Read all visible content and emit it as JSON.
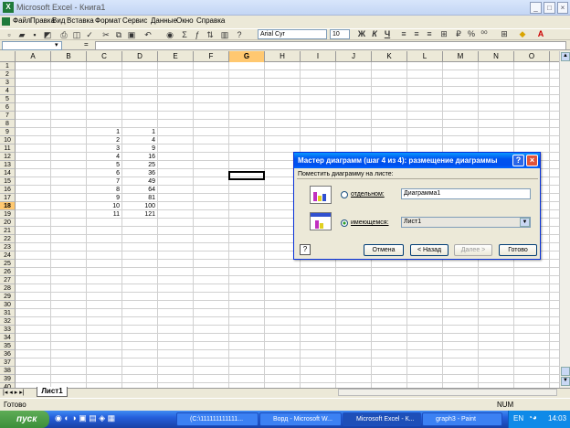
{
  "window": {
    "title": "Microsoft Excel - Книга1",
    "logo": "X"
  },
  "menu": [
    "Файл",
    "Правка",
    "Вид",
    "Вставка",
    "Формат",
    "Сервис",
    "Данные",
    "Окно",
    "Справка"
  ],
  "toolbar": {
    "font": "Arial Cyr",
    "size": "10",
    "fx": "="
  },
  "columns": [
    "A",
    "B",
    "C",
    "D",
    "E",
    "F",
    "G",
    "H",
    "I",
    "J",
    "K",
    "L",
    "M",
    "N",
    "O"
  ],
  "rows": [
    "1",
    "2",
    "3",
    "4",
    "5",
    "6",
    "7",
    "8",
    "9",
    "10",
    "11",
    "12",
    "13",
    "14",
    "15",
    "16",
    "17",
    "18",
    "19",
    "20",
    "21",
    "22",
    "23",
    "24",
    "25",
    "26",
    "27",
    "28",
    "29",
    "30",
    "31",
    "32",
    "33",
    "34",
    "35",
    "36",
    "37",
    "38",
    "39",
    "40"
  ],
  "data_c": [
    "1",
    "2",
    "3",
    "4",
    "5",
    "6",
    "7",
    "8",
    "9",
    "10",
    "11"
  ],
  "data_d": [
    "1",
    "4",
    "9",
    "16",
    "25",
    "36",
    "49",
    "64",
    "81",
    "100",
    "121"
  ],
  "sheet_tab": "Лист1",
  "status": {
    "left": "Готово",
    "num": "NUM"
  },
  "dialog": {
    "title": "Мастер диаграмм (шаг 4 из 4): размещение диаграммы",
    "prompt": "Поместить диаграмму на листе:",
    "option1": "отдельном:",
    "option1_value": "Диаграмма1",
    "option2": "имеющемся:",
    "option2_value": "Лист1",
    "cancel": "Отмена",
    "back": "< Назад",
    "next": "Далее >",
    "finish": "Готово"
  },
  "taskbar": {
    "start": "пуск",
    "tasks": [
      "(C:\\111111111111...",
      "Ворд - Microsoft W...",
      "Microsoft Excel - К...",
      "graph3 - Paint"
    ],
    "lang": "EN",
    "time": "14:03"
  }
}
